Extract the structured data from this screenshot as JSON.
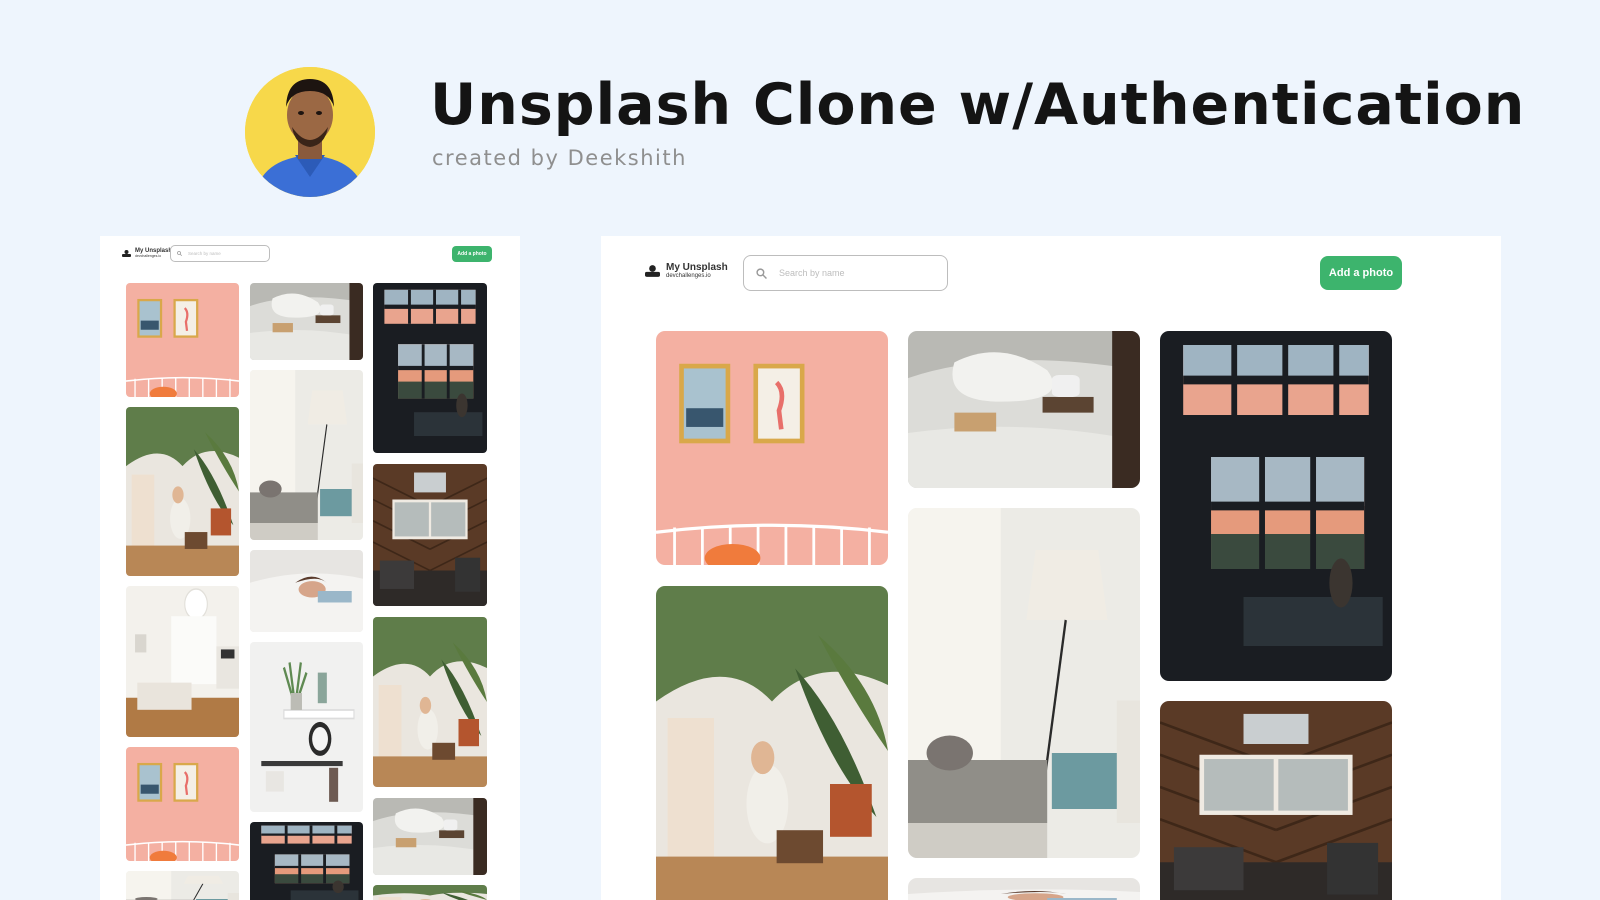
{
  "header": {
    "title": "Unsplash Clone w/Authentication",
    "subtitle": "created by Deekshith"
  },
  "app": {
    "brand_title": "My Unsplash",
    "brand_subtitle": "devchallenges.io",
    "search_placeholder": "Search by name",
    "add_button": "Add a photo"
  },
  "colors": {
    "background": "#eef5fd",
    "accent_green": "#3db46d",
    "avatar_yellow": "#f7d84a"
  },
  "gallery_photos": [
    "pink-wall-flamingo-frames",
    "bed-coffee-book",
    "dark-window-sunset-room",
    "plants-baby-reading",
    "white-room-lamp-cat",
    "wood-cabin-windows",
    "white-bedroom",
    "woman-in-bed",
    "white-wall-clock-plant"
  ]
}
